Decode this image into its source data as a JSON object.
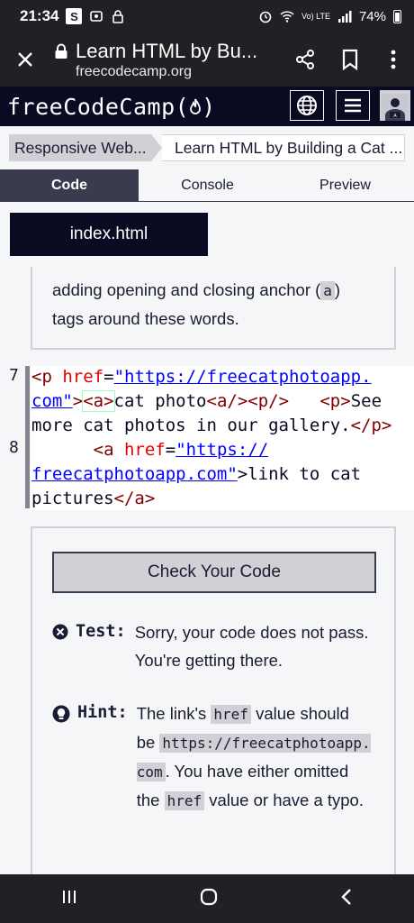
{
  "status_bar": {
    "time": "21:34",
    "s_badge": "S",
    "net_label": "Vo) LTE",
    "battery": "74%"
  },
  "browser": {
    "page_title": "Learn HTML by Bu...",
    "domain": "freecodecamp.org"
  },
  "fcc_nav": {
    "logo": "freeCodeCamp(🔥)"
  },
  "breadcrumb": {
    "first": "Responsive Web...",
    "second": "Learn HTML by Building a Cat ..."
  },
  "tabs": {
    "code": "Code",
    "console": "Console",
    "preview": "Preview"
  },
  "file_tab": "index.html",
  "description": {
    "prefix": "adding opening and closing anchor (",
    "code": "a",
    "suffix": ")",
    "line2": "tags around these words."
  },
  "code": {
    "line_7_num": "7",
    "line_8_num": "8",
    "line7a_open_tag": "<p",
    "line7a_attr": "href",
    "line7a_eq": "=",
    "line7a_str": "\"https://freecatphotoapp.",
    "line7b_str": "com\"",
    "line7b_rest_1": ">",
    "line7b_a_open": "<a>",
    "line7b_text1": "cat photo",
    "line7b_a_close": "<a/>",
    "line7b_p_close": "<p/>",
    "line7b_spacer": "   ",
    "line7b_p2": "<p>",
    "line7b_see": "See",
    "line7c_text": "more cat photos in our gallery.",
    "line7c_pclose": "</p>",
    "line8a_indent": "      ",
    "line8a_tag": "<a",
    "line8a_attr": "href",
    "line8a_eq": "=",
    "line8a_str": "\"https://",
    "line8b_str": "freecatphotoapp.com\"",
    "line8b_rest": ">link to cat",
    "line8c_text": "pictures",
    "line8c_close": "</a>"
  },
  "test_panel": {
    "check_button": "Check Your Code",
    "test_label": "Test:",
    "test_msg": "Sorry, your code does not pass. You're getting there.",
    "hint_label": "Hint:",
    "hint_msg_1": "The link's ",
    "hint_code_1": "href",
    "hint_msg_2": " value should be ",
    "hint_code_2": "https://freecatphotoapp.com",
    "hint_msg_3": ". You have either omitted the ",
    "hint_code_3": "href",
    "hint_msg_4": " value or have a typo."
  },
  "icons": {
    "close": "close-icon",
    "lock": "lock-icon",
    "share": "share-icon",
    "bookmark": "bookmark-icon",
    "more": "more-vert-icon",
    "globe": "globe-icon",
    "menu": "menu-icon"
  }
}
